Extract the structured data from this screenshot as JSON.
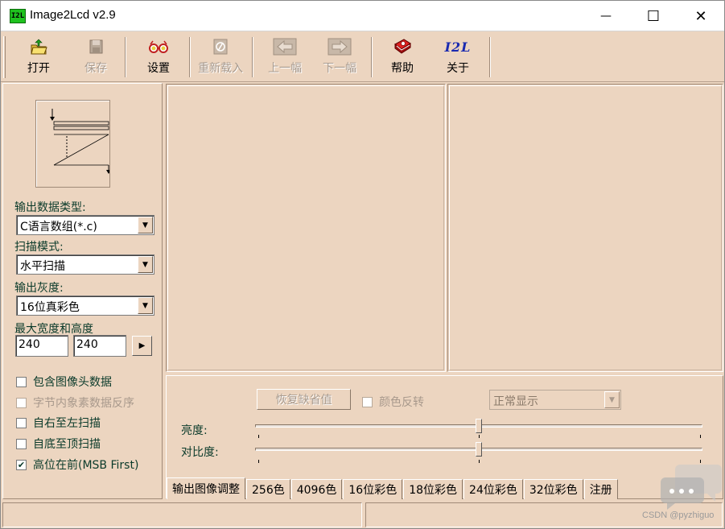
{
  "window": {
    "app_icon_text": "I2L",
    "title": "Image2Lcd v2.9",
    "minimize_glyph": "—",
    "maximize_glyph": "☐",
    "close_glyph": "✕"
  },
  "toolbar": {
    "buttons": [
      {
        "label": "打开",
        "icon": "open-folder-icon",
        "enabled": true
      },
      {
        "label": "保存",
        "icon": "save-icon",
        "enabled": false
      },
      {
        "label": "设置",
        "icon": "settings-glasses-icon",
        "enabled": true
      },
      {
        "label": "重新载入",
        "icon": "reload-icon",
        "enabled": false
      },
      {
        "label": "上一幅",
        "icon": "previous-icon",
        "enabled": false
      },
      {
        "label": "下一幅",
        "icon": "next-icon",
        "enabled": false
      },
      {
        "label": "帮助",
        "icon": "help-book-icon",
        "enabled": true
      },
      {
        "label": "关于",
        "icon": "about-i2l-icon",
        "enabled": true
      }
    ],
    "about_icon_text": "I2L"
  },
  "settings": {
    "output_type_label": "输出数据类型:",
    "output_type_value": "C语言数组(*.c)",
    "scan_mode_label": "扫描模式:",
    "scan_mode_value": "水平扫描",
    "gray_label": "输出灰度:",
    "gray_value": "16位真彩色",
    "size_label": "最大宽度和高度",
    "max_width": "240",
    "max_height": "240",
    "checkboxes": [
      {
        "label": "包含图像头数据",
        "checked": false,
        "enabled": true
      },
      {
        "label": "字节内象素数据反序",
        "checked": false,
        "enabled": false
      },
      {
        "label": "自右至左扫描",
        "checked": false,
        "enabled": true
      },
      {
        "label": "自底至顶扫描",
        "checked": false,
        "enabled": true
      },
      {
        "label": "高位在前(MSB First)",
        "checked": true,
        "enabled": true
      }
    ],
    "check_glyph": "✔"
  },
  "adjust": {
    "restore_default_label": "恢复缺省值",
    "invert_color_label": "颜色反转",
    "display_mode_value": "正常显示",
    "brightness_label": "亮度:",
    "contrast_label": "对比度:",
    "brightness_level": 0.5,
    "contrast_level": 0.5
  },
  "tabs": [
    "输出图像调整",
    "256色",
    "4096色",
    "16位彩色",
    "18位彩色",
    "24位彩色",
    "32位彩色",
    "注册"
  ],
  "active_tab": 0,
  "watermark": {
    "text": "CSDN @pyzhiguo"
  }
}
